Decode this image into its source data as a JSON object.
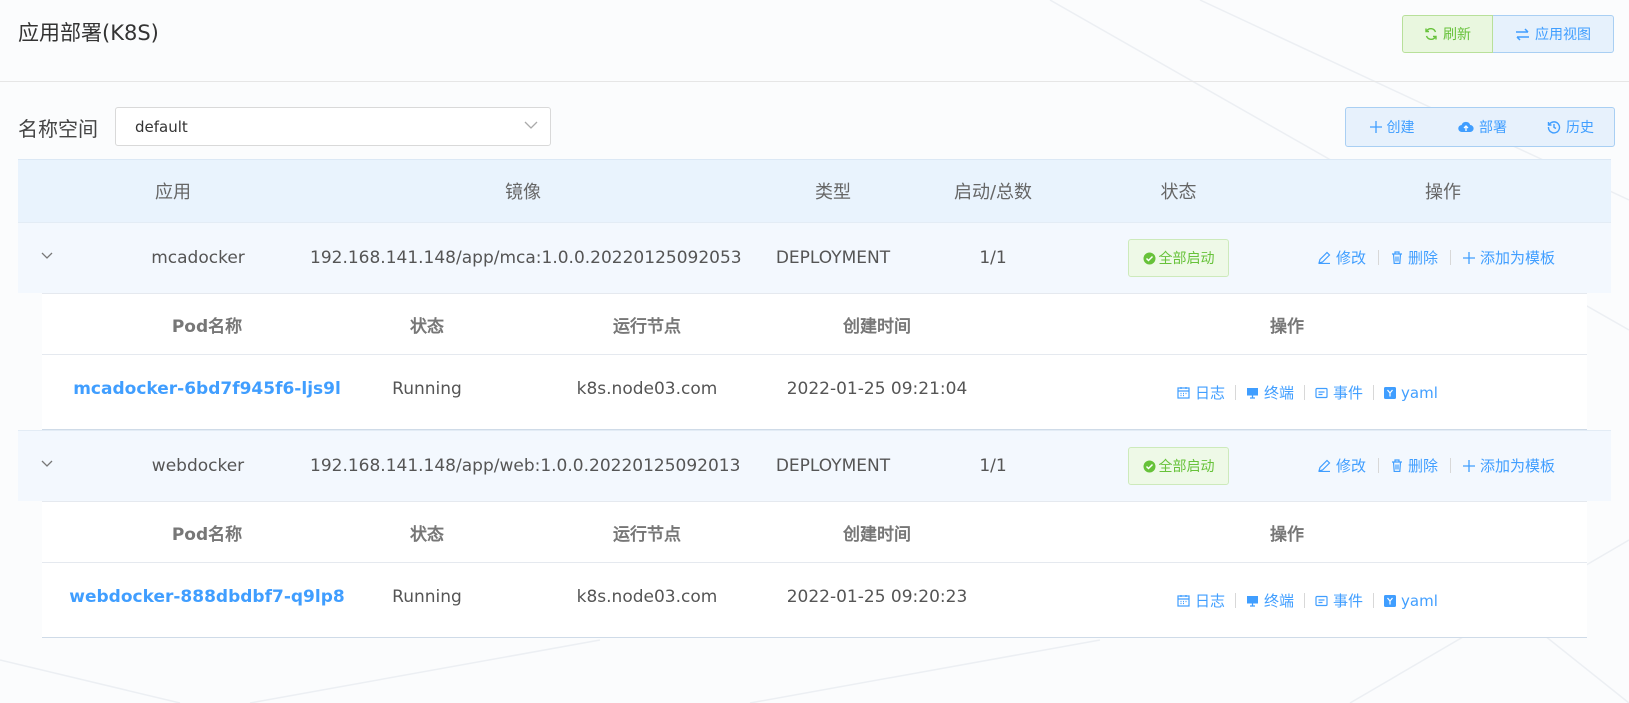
{
  "header": {
    "title": "应用部署(K8S)",
    "refresh_label": "刷新",
    "app_view_label": "应用视图"
  },
  "filter": {
    "namespace_label": "名称空间",
    "namespace_value": "default"
  },
  "actions": {
    "create_label": "创建",
    "deploy_label": "部署",
    "history_label": "历史"
  },
  "table": {
    "columns": [
      "应用",
      "镜像",
      "类型",
      "启动/总数",
      "状态",
      "操作"
    ],
    "pod_columns": [
      "Pod名称",
      "状态",
      "运行节点",
      "创建时间",
      "操作"
    ],
    "row_ops": [
      "修改",
      "删除",
      "添加为模板"
    ],
    "pod_ops": [
      "日志",
      "终端",
      "事件",
      "yaml"
    ],
    "apps": [
      {
        "name": "mcadocker",
        "image": "192.168.141.148/app/mca:1.0.0.20220125092053",
        "type": "DEPLOYMENT",
        "count": "1/1",
        "status": "全部启动",
        "pods": [
          {
            "name": "mcadocker-6bd7f945f6-ljs9l",
            "status": "Running",
            "node": "k8s.node03.com",
            "created": "2022-01-25 09:21:04"
          }
        ]
      },
      {
        "name": "webdocker",
        "image": "192.168.141.148/app/web:1.0.0.20220125092013",
        "type": "DEPLOYMENT",
        "count": "1/1",
        "status": "全部启动",
        "pods": [
          {
            "name": "webdocker-888dbdbf7-q9lp8",
            "status": "Running",
            "node": "k8s.node03.com",
            "created": "2022-01-25 09:20:23"
          }
        ]
      }
    ]
  },
  "colors": {
    "primary": "#409eff",
    "success": "#67c23a",
    "header_bg": "#e9f3fd",
    "row_bg": "#f3f8fe"
  }
}
